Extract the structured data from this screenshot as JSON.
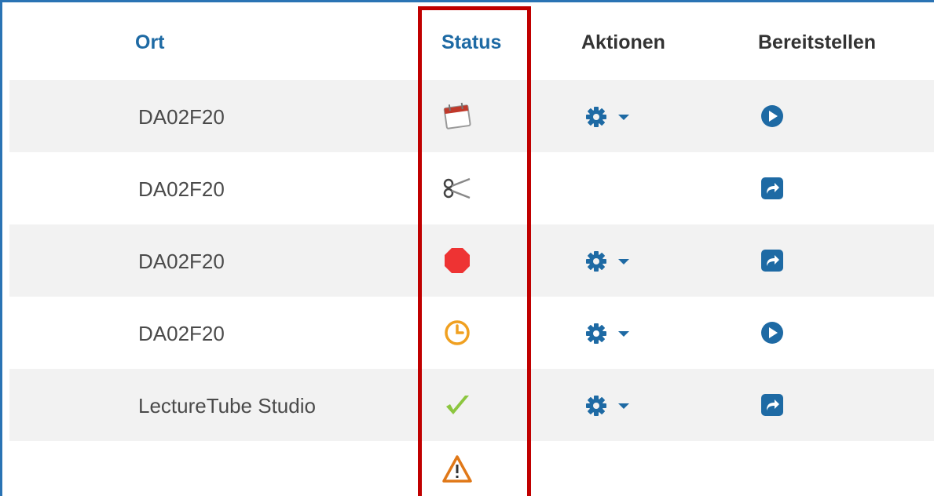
{
  "table": {
    "headers": {
      "ort": "Ort",
      "status": "Status",
      "aktionen": "Aktionen",
      "bereitstellen": "Bereitstellen"
    },
    "rows": [
      {
        "ort": "DA02F20",
        "status_icon": "calendar-icon",
        "has_actions": true,
        "deploy_icon": "play-circle-icon"
      },
      {
        "ort": "DA02F20",
        "status_icon": "scissors-icon",
        "has_actions": false,
        "deploy_icon": "share-square-icon"
      },
      {
        "ort": "DA02F20",
        "status_icon": "stop-octagon-icon",
        "has_actions": true,
        "deploy_icon": "share-square-icon"
      },
      {
        "ort": "DA02F20",
        "status_icon": "clock-icon",
        "has_actions": true,
        "deploy_icon": "play-circle-icon"
      },
      {
        "ort": "LectureTube Studio",
        "status_icon": "checkmark-icon",
        "has_actions": true,
        "deploy_icon": "share-square-icon"
      },
      {
        "ort": "",
        "status_icon": "warning-triangle-icon",
        "has_actions": false,
        "deploy_icon": ""
      }
    ]
  },
  "colors": {
    "link": "#1e6aa4",
    "highlight": "#c00000",
    "row_alt": "#f2f2f2",
    "stop": "#ee3333",
    "clock": "#f0a020",
    "check": "#8cc63f",
    "warning": "#e07818"
  }
}
